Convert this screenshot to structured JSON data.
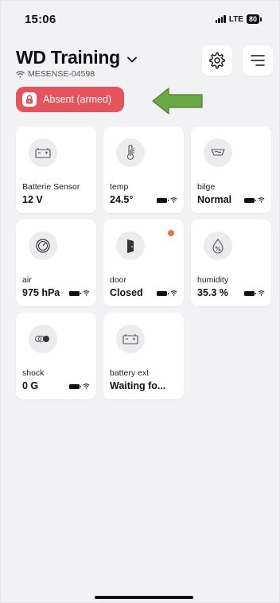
{
  "status_bar": {
    "time": "15:06",
    "network": "LTE",
    "battery": "80"
  },
  "header": {
    "title": "WD Training",
    "device_id": "MESENSE-04598"
  },
  "alarm": {
    "label": "Absent (armed)",
    "color": "#e5535d"
  },
  "annotation": {
    "arrow_color": "#6aa845"
  },
  "sensors": [
    {
      "name": "Batterie Sensor",
      "value": "12 V",
      "icon": "battery-icon",
      "show_meta": false,
      "alert": false
    },
    {
      "name": "temp",
      "value": "24.5°",
      "icon": "thermometer-icon",
      "show_meta": true,
      "alert": false
    },
    {
      "name": "bilge",
      "value": "Normal",
      "icon": "bilge-icon",
      "show_meta": true,
      "alert": false
    },
    {
      "name": "air",
      "value": "975 hPa",
      "icon": "gauge-icon",
      "show_meta": true,
      "alert": false
    },
    {
      "name": "door",
      "value": "Closed",
      "icon": "door-icon",
      "show_meta": true,
      "alert": true
    },
    {
      "name": "humidity",
      "value": "35.3 %",
      "icon": "humidity-icon",
      "show_meta": true,
      "alert": false
    },
    {
      "name": "shock",
      "value": "0 G",
      "icon": "shock-icon",
      "show_meta": true,
      "alert": false
    },
    {
      "name": "battery ext",
      "value": "Waiting fo...",
      "icon": "battery-icon",
      "show_meta": false,
      "alert": false
    }
  ]
}
